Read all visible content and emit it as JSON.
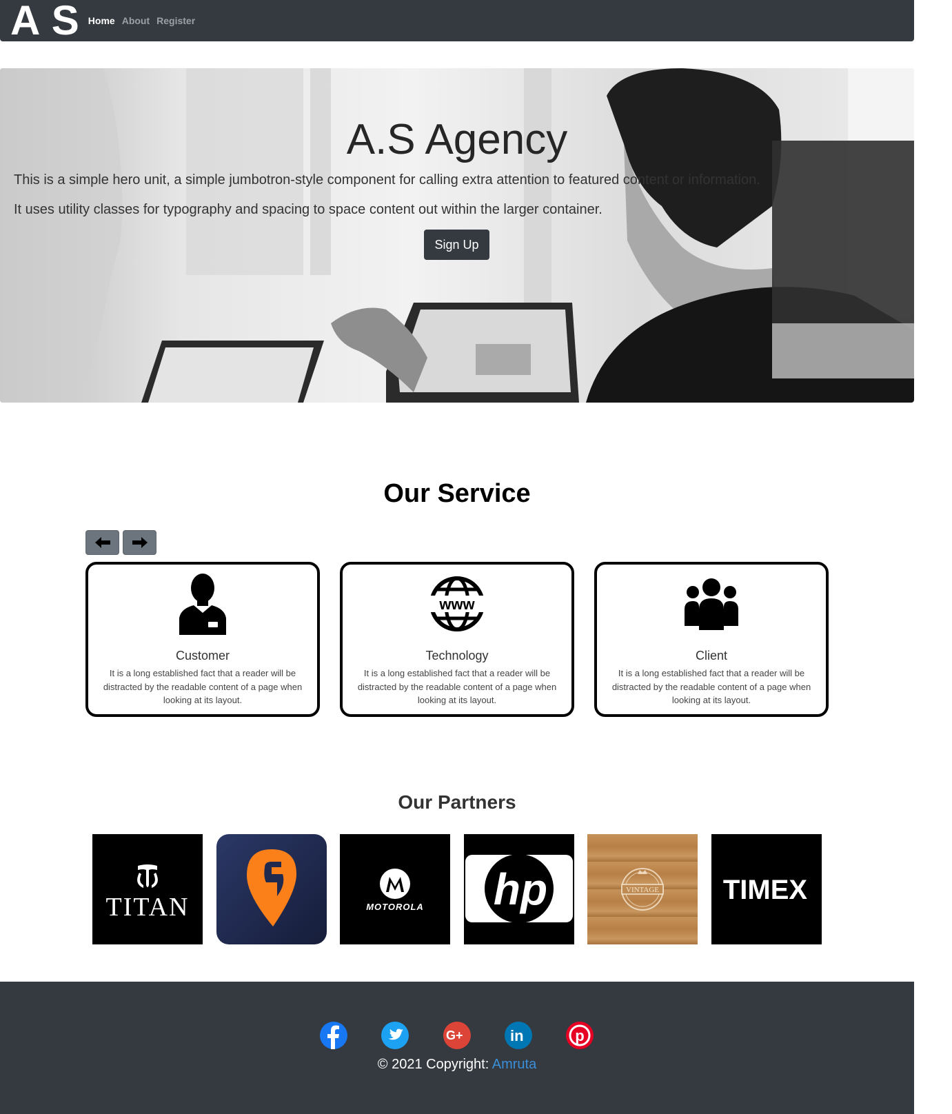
{
  "navbar": {
    "brand": "A S",
    "links": [
      {
        "label": "Home",
        "active": true
      },
      {
        "label": "About",
        "active": false
      },
      {
        "label": "Register",
        "active": false
      }
    ]
  },
  "hero": {
    "title": "A.S Agency",
    "lead1": "This is a simple hero unit, a simple jumbotron-style component for calling extra attention to featured content or information.",
    "lead2": "It uses utility classes for typography and spacing to space content out within the larger container.",
    "button": "Sign Up"
  },
  "services": {
    "title": "Our Service",
    "prev_icon": "arrow-left-icon",
    "next_icon": "arrow-right-icon",
    "cards": [
      {
        "icon": "customer-icon",
        "name": "Customer",
        "desc": "It is a long established fact that a reader will be distracted by the readable content of a page when looking at its layout."
      },
      {
        "icon": "www-globe-icon",
        "name": "Technology",
        "desc": "It is a long established fact that a reader will be distracted by the readable content of a page when looking at its layout."
      },
      {
        "icon": "group-icon",
        "name": "Client",
        "desc": "It is a long established fact that a reader will be distracted by the readable content of a page when looking at its layout."
      }
    ]
  },
  "partners": {
    "title": "Our Partners",
    "logos": [
      {
        "name": "TITAN",
        "bg": "#000000"
      },
      {
        "name": "swiggy",
        "bg": "#1f2a4e"
      },
      {
        "name": "MOTOROLA",
        "bg": "#000000"
      },
      {
        "name": "hp",
        "bg": "#000000"
      },
      {
        "name": "VINTAGE",
        "bg": "#b9874f"
      },
      {
        "name": "TIMEX",
        "bg": "#000000"
      }
    ]
  },
  "footer": {
    "social": [
      {
        "icon": "facebook-icon",
        "color": "#1877f2"
      },
      {
        "icon": "twitter-icon",
        "color": "#1da1f2"
      },
      {
        "icon": "google-plus-icon",
        "color": "#db4437"
      },
      {
        "icon": "linkedin-icon",
        "color": "#0077b5"
      },
      {
        "icon": "pinterest-icon",
        "color": "#e60023"
      }
    ],
    "copyright": "© 2021 Copyright: ",
    "author": "Amruta"
  }
}
